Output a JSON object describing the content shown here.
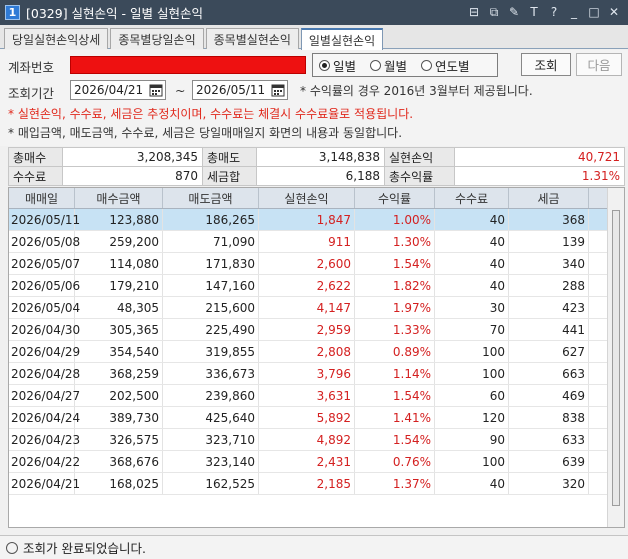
{
  "window": {
    "num": "1",
    "title": "[0329] 실현손익 - 일별 실현손익"
  },
  "tabs": [
    {
      "label": "당일실현손익상세",
      "active": false
    },
    {
      "label": "종목별당일손익",
      "active": false
    },
    {
      "label": "종목별실현손익",
      "active": false
    },
    {
      "label": "일별실현손익",
      "active": true
    }
  ],
  "form": {
    "account_label": "계좌번호",
    "period_label": "조회기간",
    "radios": [
      {
        "label": "일별",
        "checked": true
      },
      {
        "label": "월별",
        "checked": false
      },
      {
        "label": "연도별",
        "checked": false
      }
    ],
    "search_label": "조회",
    "next_label": "다음",
    "date_from": "2026/04/21",
    "date_to": "2026/05/11",
    "tilde": "~",
    "notes": [
      "* 수익률의 경우 2016년 3월부터 제공됩니다.",
      "* 실현손익, 수수료, 세금은 추정치이며, 수수료는 체결시 수수료율로 적용됩니다.",
      "* 매입금액, 매도금액, 수수료, 세금은 당일매매일지 화면의 내용과 동일합니다."
    ]
  },
  "summary": {
    "row1": {
      "l1": "총매수",
      "v1": "3,208,345",
      "l2": "총매도",
      "v2": "3,148,838",
      "l3": "실현손익",
      "v3": "40,721"
    },
    "row2": {
      "l1": "수수료",
      "v1": "870",
      "l2": "세금합",
      "v2": "6,188",
      "l3": "총수익률",
      "v3": "1.31%"
    }
  },
  "grid": {
    "headers": [
      "매매일",
      "매수금액",
      "매도금액",
      "실현손익",
      "수익률",
      "수수료",
      "세금"
    ],
    "rows": [
      [
        "2026/05/11",
        "123,880",
        "186,265",
        "1,847",
        "1.00%",
        "40",
        "368"
      ],
      [
        "2026/05/08",
        "259,200",
        "71,090",
        "911",
        "1.30%",
        "40",
        "139"
      ],
      [
        "2026/05/07",
        "114,080",
        "171,830",
        "2,600",
        "1.54%",
        "40",
        "340"
      ],
      [
        "2026/05/06",
        "179,210",
        "147,160",
        "2,622",
        "1.82%",
        "40",
        "288"
      ],
      [
        "2026/05/04",
        "48,305",
        "215,600",
        "4,147",
        "1.97%",
        "30",
        "423"
      ],
      [
        "2026/04/30",
        "305,365",
        "225,490",
        "2,959",
        "1.33%",
        "70",
        "441"
      ],
      [
        "2026/04/29",
        "354,540",
        "319,855",
        "2,808",
        "0.89%",
        "100",
        "627"
      ],
      [
        "2026/04/28",
        "368,259",
        "336,673",
        "3,796",
        "1.14%",
        "100",
        "663"
      ],
      [
        "2026/04/27",
        "202,500",
        "239,860",
        "3,631",
        "1.54%",
        "60",
        "469"
      ],
      [
        "2026/04/24",
        "389,730",
        "425,640",
        "5,892",
        "1.41%",
        "120",
        "838"
      ],
      [
        "2026/04/23",
        "326,575",
        "323,710",
        "4,892",
        "1.54%",
        "90",
        "633"
      ],
      [
        "2026/04/22",
        "368,676",
        "323,140",
        "2,431",
        "0.76%",
        "100",
        "639"
      ],
      [
        "2026/04/21",
        "168,025",
        "162,525",
        "2,185",
        "1.37%",
        "40",
        "320"
      ]
    ],
    "selected_index": 0
  },
  "status": {
    "message": "조회가 완료되었습니다."
  },
  "colors": {
    "profit": "#d42020",
    "selected_row": "#c7e2f4",
    "account_mask": "#ee1111"
  }
}
